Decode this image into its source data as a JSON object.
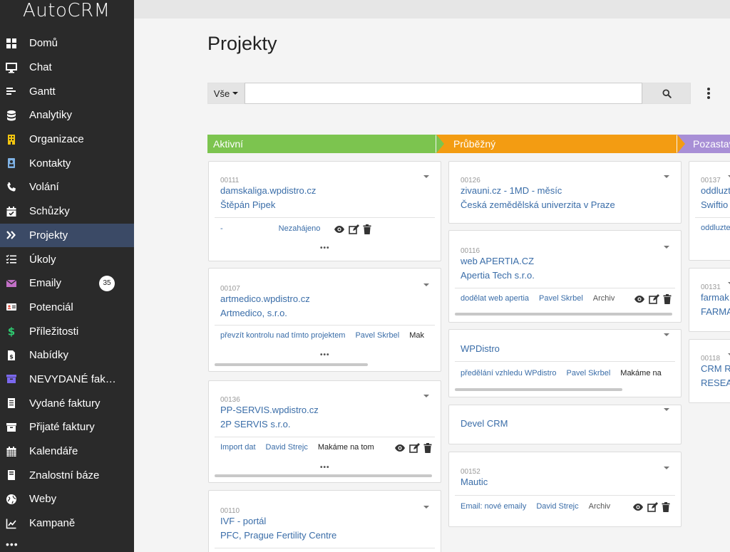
{
  "app": {
    "logo": "AutoCRM"
  },
  "sidebar": {
    "items": [
      {
        "label": "Domů",
        "icon": "grid-icon"
      },
      {
        "label": "Chat",
        "icon": "monitor-icon"
      },
      {
        "label": "Gantt",
        "icon": "gantt-icon"
      },
      {
        "label": "Analytiky",
        "icon": "database-icon"
      },
      {
        "label": "Organizace",
        "icon": "building-icon"
      },
      {
        "label": "Kontakty",
        "icon": "contact-card-icon"
      },
      {
        "label": "Volání",
        "icon": "phone-icon"
      },
      {
        "label": "Schůzky",
        "icon": "calendar-check-icon"
      },
      {
        "label": "Projekty",
        "icon": "chevrons-right-icon",
        "active": true
      },
      {
        "label": "Úkoly",
        "icon": "tasks-icon"
      },
      {
        "label": "Emaily",
        "icon": "envelope-icon",
        "badge": "35"
      },
      {
        "label": "Potenciál",
        "icon": "id-card-icon"
      },
      {
        "label": "Příležitosti",
        "icon": "dollar-icon"
      },
      {
        "label": "Nabídky",
        "icon": "file-dollar-icon"
      },
      {
        "label": "NEVYDANÉ fak…",
        "icon": "archive-icon"
      },
      {
        "label": "Vydané faktury",
        "icon": "invoice-icon"
      },
      {
        "label": "Přijaté faktury",
        "icon": "inbox-icon"
      },
      {
        "label": "Kalendáře",
        "icon": "calendar-icon"
      },
      {
        "label": "Znalostní báze",
        "icon": "book-icon"
      },
      {
        "label": "Weby",
        "icon": "globe-icon"
      },
      {
        "label": "Kampaně",
        "icon": "chart-line-icon"
      }
    ],
    "more": "•••"
  },
  "page": {
    "title": "Projekty"
  },
  "search": {
    "filter_label": "Vše",
    "placeholder": ""
  },
  "stages": [
    {
      "label": "Aktivní",
      "color": "#7cc44f"
    },
    {
      "label": "Průběžný",
      "color": "#f39c12"
    },
    {
      "label": "Pozastaveno",
      "color": "#a88fd6"
    }
  ],
  "columns": [
    {
      "cards": [
        {
          "id": "00111",
          "line1": "damskaliga.wpdistro.cz",
          "line2": "Štěpán Pipek",
          "foot_a": "-",
          "foot_b": "Nezahájeno",
          "foot_c": "",
          "more": "•••"
        },
        {
          "id": "00107",
          "line1": "artmedico.wpdistro.cz",
          "line2": "Artmedico, s.r.o.",
          "foot_a": "převzít kontrolu nad tímto projektem",
          "foot_b": "Pavel Skrbel",
          "foot_c": "Mak",
          "more": "•••"
        },
        {
          "id": "00136",
          "line1": "PP-SERVIS.wpdistro.cz",
          "line2": "2P SERVIS s.r.o.",
          "foot_a": "Import dat",
          "foot_b": "David Strejc",
          "foot_c": "Makáme na tom",
          "more": "•••"
        },
        {
          "id": "00110",
          "line1": "IVF - portál",
          "line2": "PFC, Prague Fertility Centre"
        }
      ]
    },
    {
      "cards": [
        {
          "id": "00126",
          "line1": "zivauni.cz - 1MD - měsíc",
          "line2": "Česká zemědělská univerzita v Praze"
        },
        {
          "id": "00116",
          "line1": "web APERTIA.CZ",
          "line2": "Apertia Tech s.r.o.",
          "foot_a": "dodělat web apertia",
          "foot_b": "Pavel Skrbel",
          "foot_c": "Archiv"
        },
        {
          "id": "",
          "line1": "WPDistro",
          "line2": "",
          "foot_a": "předělání vzhledu WPdistro",
          "foot_b": "Pavel Skrbel",
          "foot_c": "Makáme na"
        },
        {
          "id": "",
          "line1": "Devel CRM",
          "line2": ""
        },
        {
          "id": "00152",
          "line1": "Mautic",
          "line2": "",
          "foot_a": "Email: nové emaily",
          "foot_b": "David Strejc",
          "foot_c": "Archiv"
        }
      ]
    },
    {
      "cards": [
        {
          "id": "00137",
          "line1": "oddluzt",
          "line2": "Swiftio",
          "foot_a": "oddluzte"
        },
        {
          "id": "00131",
          "line1": "farmak.",
          "line2": "FARMA"
        },
        {
          "id": "00118",
          "line1": "CRM R",
          "line2": "RESEA"
        }
      ]
    }
  ]
}
